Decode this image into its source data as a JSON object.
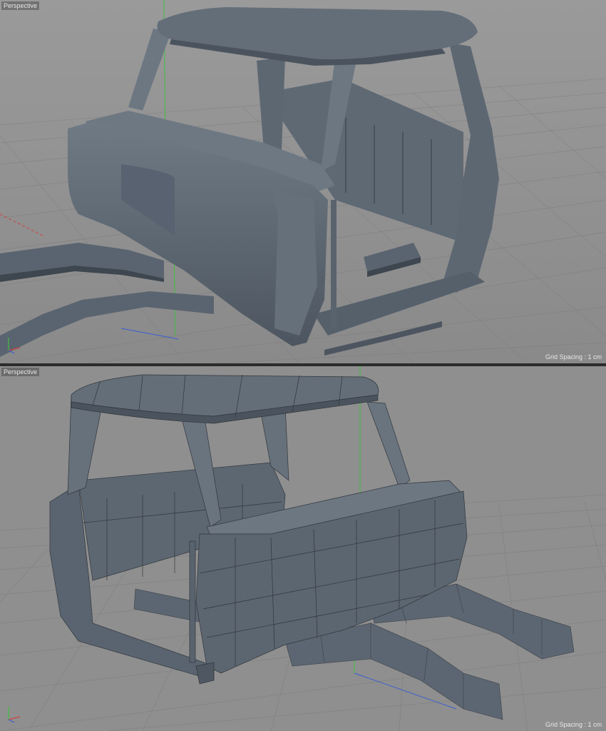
{
  "viewports": [
    {
      "label": "Perspective",
      "grid_spacing": "Grid Spacing : 1 cm",
      "display_mode": "shaded"
    },
    {
      "label": "Perspective",
      "grid_spacing": "Grid Spacing : 1 cm",
      "display_mode": "shaded-wireframe"
    }
  ],
  "axis_labels": {
    "y": "Y",
    "x": "X",
    "z": "Z"
  },
  "colors": {
    "background": "#8f8f8f",
    "grid": "#7a7a7a",
    "mesh": "#5d6772",
    "mesh_dark": "#3f4750",
    "mesh_light": "#7b858f",
    "y_axis": "#3fbf3f",
    "x_axis": "#d04040",
    "z_axis": "#3a5fd0"
  }
}
